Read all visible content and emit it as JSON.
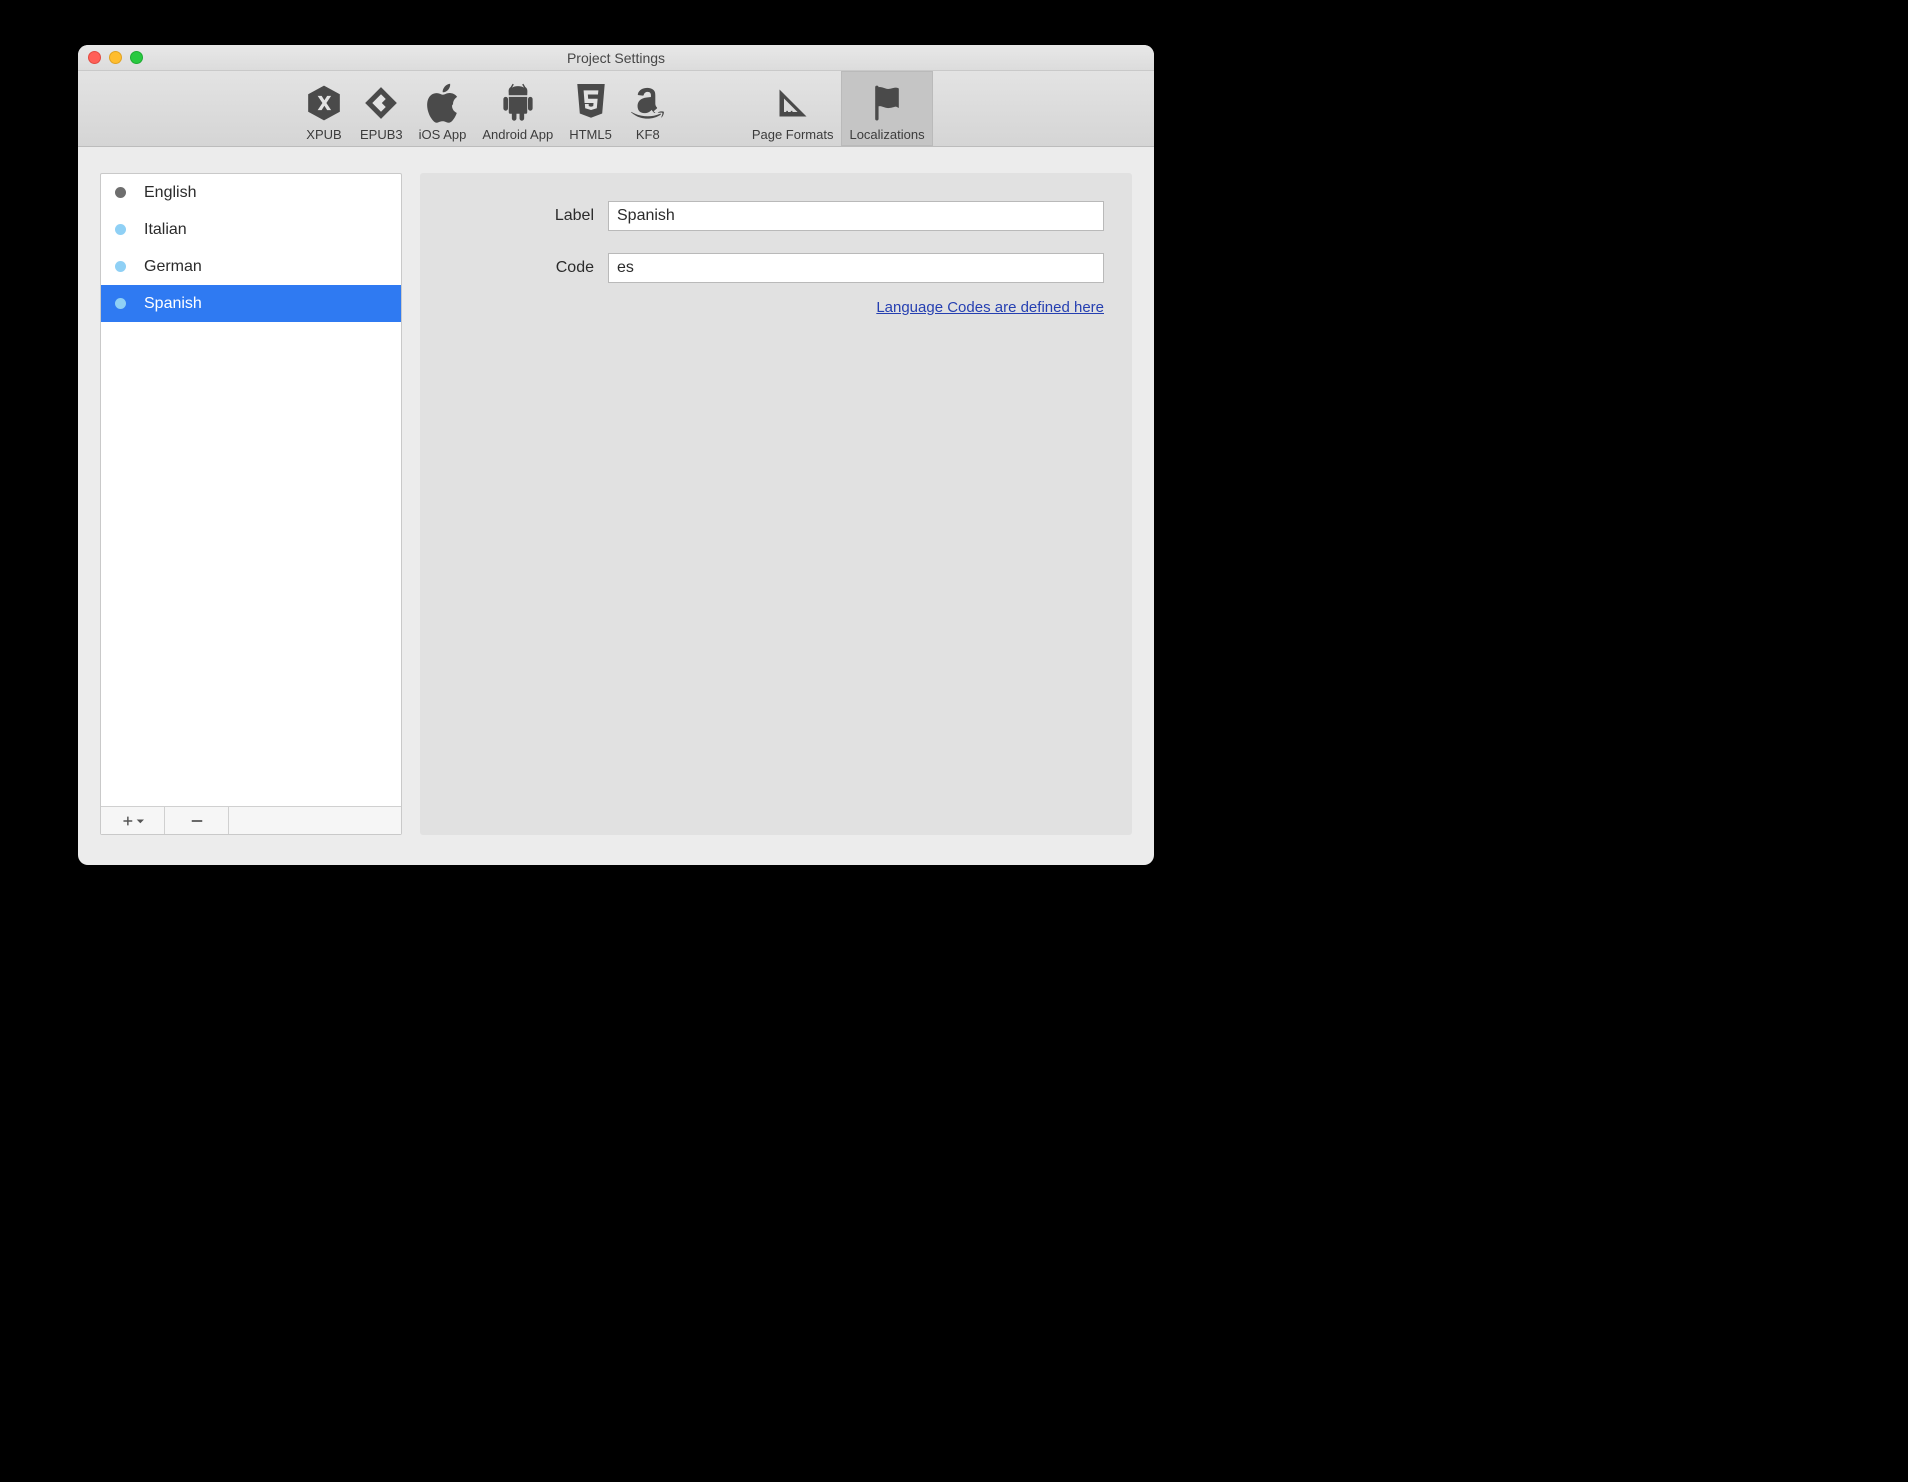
{
  "window": {
    "title": "Project Settings"
  },
  "toolbar": {
    "items": [
      {
        "label": "XPUB"
      },
      {
        "label": "EPUB3"
      },
      {
        "label": "iOS App"
      },
      {
        "label": "Android App"
      },
      {
        "label": "HTML5"
      },
      {
        "label": "KF8"
      }
    ],
    "right_items": [
      {
        "label": "Page Formats"
      },
      {
        "label": "Localizations"
      }
    ],
    "active": "Localizations"
  },
  "language_list": {
    "items": [
      {
        "label": "English",
        "dot": "#6e6e6e",
        "selected": false
      },
      {
        "label": "Italian",
        "dot": "#8fd0f5",
        "selected": false
      },
      {
        "label": "German",
        "dot": "#8fd0f5",
        "selected": false
      },
      {
        "label": "Spanish",
        "dot": "#8fd0f5",
        "selected": true
      }
    ]
  },
  "form": {
    "label_caption": "Label",
    "label_value": "Spanish",
    "code_caption": "Code",
    "code_value": "es",
    "link_text": "Language Codes are defined here"
  }
}
